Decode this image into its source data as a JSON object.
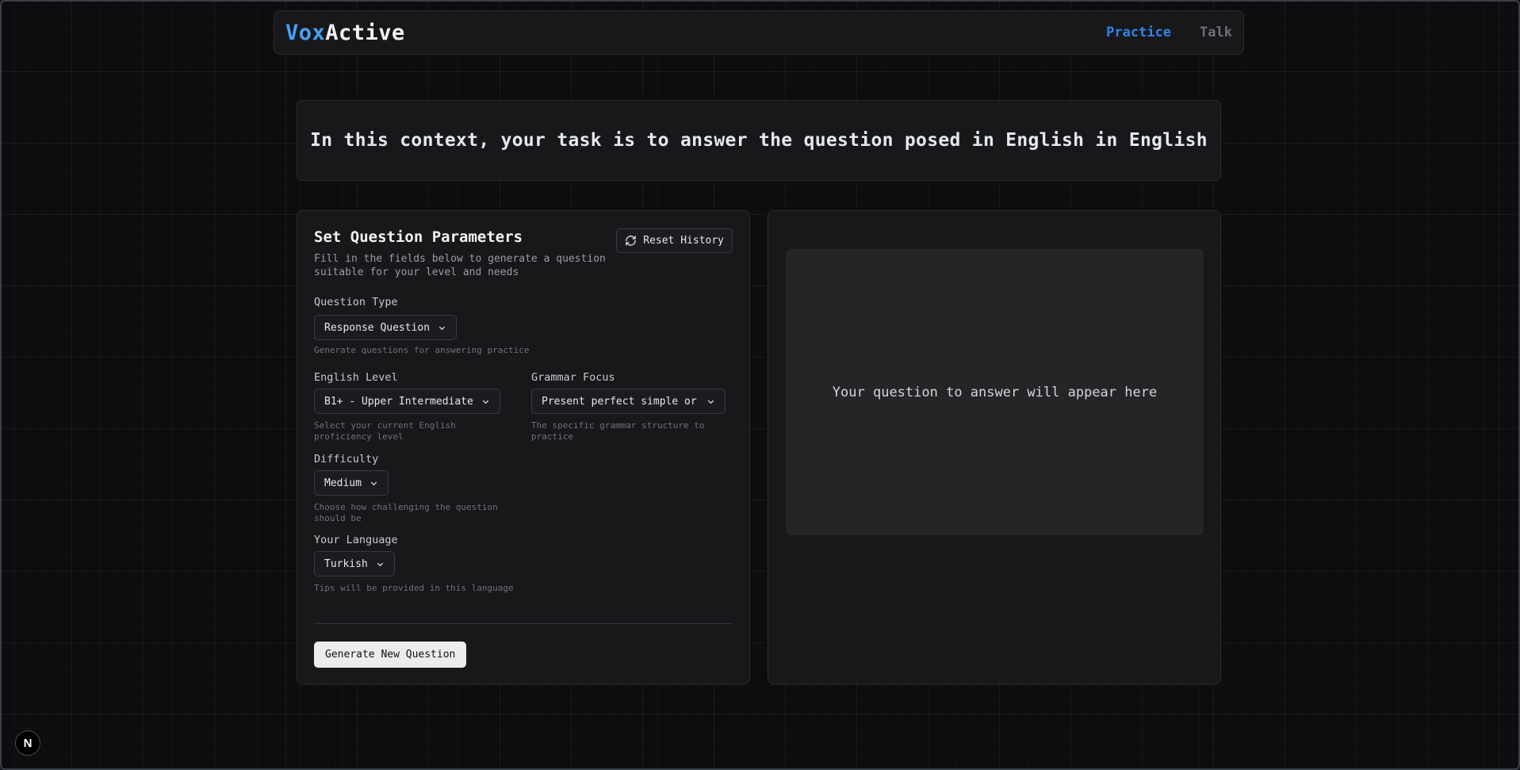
{
  "header": {
    "logo_part1": "Vox",
    "logo_part2": "Active",
    "nav": {
      "practice": "Practice",
      "talk": "Talk"
    }
  },
  "banner": {
    "text": "In this context, your task is to answer the question posed in English in English"
  },
  "params": {
    "title": "Set Question Parameters",
    "description": "Fill in the fields below to generate a question suitable for your level and needs",
    "reset_label": "Reset History",
    "question_type": {
      "label": "Question Type",
      "value": "Response Question",
      "help": "Generate questions for answering practice"
    },
    "english_level": {
      "label": "English Level",
      "value": "B1+ - Upper Intermediate",
      "help": "Select your current English proficiency level"
    },
    "grammar_focus": {
      "label": "Grammar Focus",
      "value": "Present perfect simple or",
      "help": "The specific grammar structure to practice"
    },
    "difficulty": {
      "label": "Difficulty",
      "value": "Medium",
      "help": "Choose how challenging the question should be"
    },
    "language": {
      "label": "Your Language",
      "value": "Turkish",
      "help": "Tips will be provided in this language"
    },
    "generate_label": "Generate New Question"
  },
  "output": {
    "placeholder": "Your question to answer will appear here"
  },
  "badge": {
    "letter": "N"
  },
  "colors": {
    "accent": "#2f86e8",
    "logo_accent": "#4a9ff5",
    "background": "#0d0d0f",
    "panel": "#18181b"
  }
}
